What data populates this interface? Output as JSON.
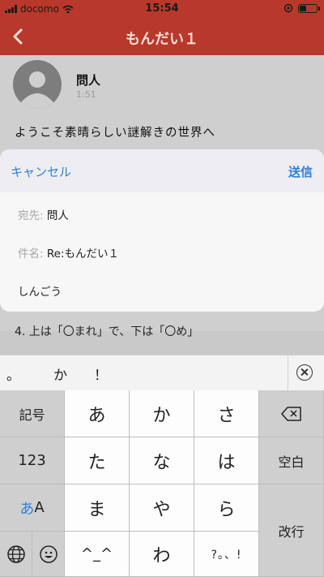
{
  "status_bar": {
    "carrier": "docomo",
    "time": "15:54",
    "battery_level": 0.35
  },
  "nav": {
    "title": "もんだい１",
    "back_icon": "chevron-left-icon"
  },
  "post": {
    "author": "問人",
    "time": "1:51",
    "body": "ようこそ素晴らしい謎解きの世界へ",
    "peek_line": "4. 上は「〇まれ」で、下は「〇め」"
  },
  "compose": {
    "cancel_label": "キャンセル",
    "send_label": "送信",
    "to_label": "宛先:",
    "to_value": "問人",
    "subject_label": "件名:",
    "subject_value": "Re:もんだい１",
    "body_text": "しんごう"
  },
  "keyboard": {
    "candidates": [
      "。",
      "か",
      "！"
    ],
    "rows": [
      [
        "記号",
        "あ",
        "か",
        "さ",
        "⌫"
      ],
      [
        "123",
        "た",
        "な",
        "は",
        "空白"
      ],
      [
        "あA",
        "ま",
        "や",
        "ら",
        "改行"
      ],
      [
        "globe",
        "emoji",
        "^_^",
        "わ",
        "?。、!"
      ]
    ],
    "mode_key_colored": "あ",
    "mode_key_plain": "A",
    "colors": {
      "accent": "#b8392b",
      "link": "#2f80d6"
    }
  }
}
